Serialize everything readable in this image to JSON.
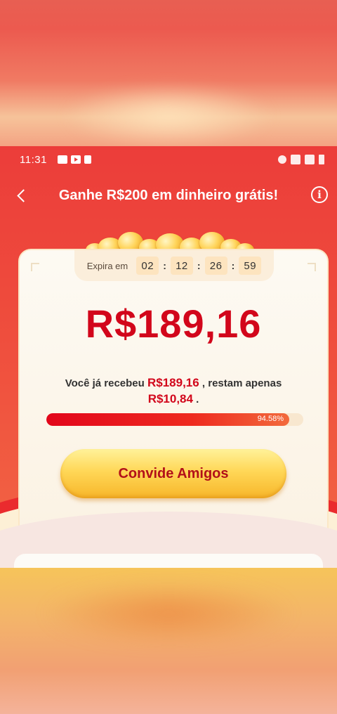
{
  "status_bar": {
    "time": "11:31"
  },
  "header": {
    "title": "Ganhe R$200 em dinheiro grátis!",
    "info_label": "i"
  },
  "card": {
    "timer": {
      "label": "Expira em",
      "hours": "02",
      "minutes": "12",
      "seconds": "26",
      "centiseconds": "59",
      "separator": ":"
    },
    "amount": "R$189,16",
    "received_prefix": "Você já recebeu",
    "received_amount": "R$189,16",
    "received_mid": ", restam apenas",
    "remaining_amount": "R$10,84",
    "received_suffix": ".",
    "progress_label": "94.58%",
    "progress_value": 0.9458,
    "invite_button": "Convide Amigos"
  },
  "colors": {
    "primary_red": "#d2061b",
    "background_red": "#ec3d3a",
    "button_gold": "#ffd757"
  }
}
